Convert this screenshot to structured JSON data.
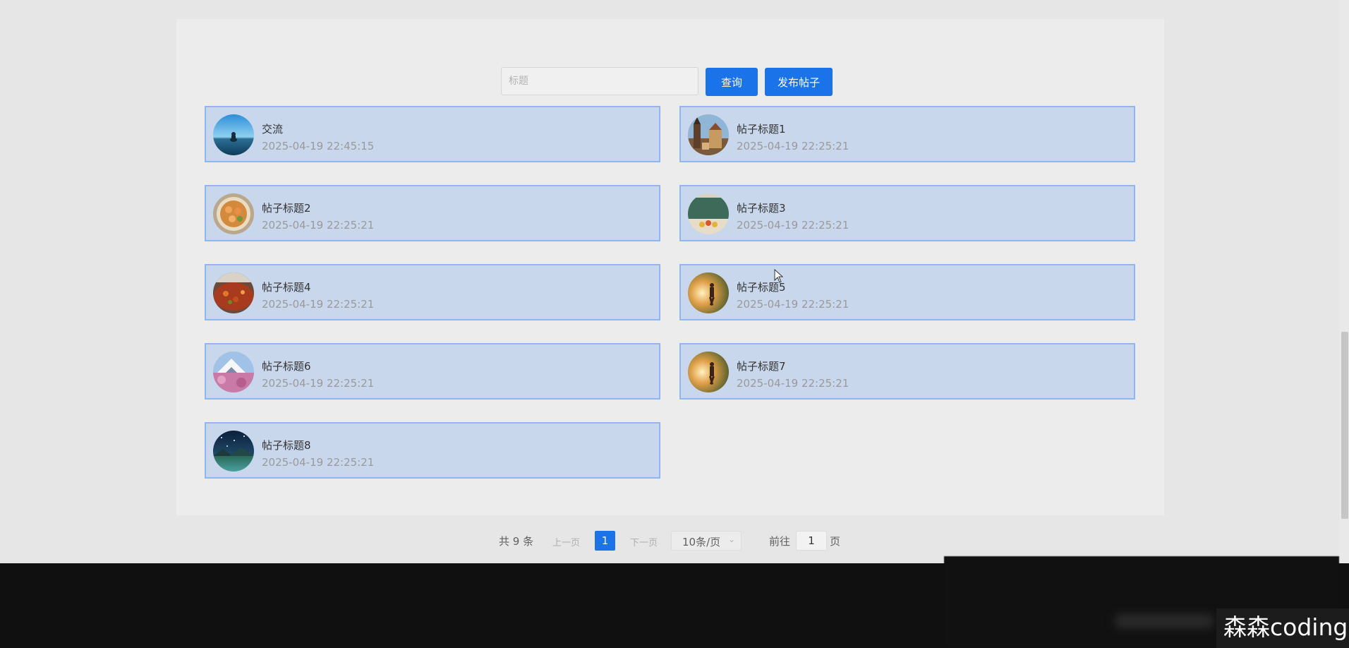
{
  "search": {
    "placeholder": "标题",
    "query_label": "查询",
    "publish_label": "发布帖子"
  },
  "posts": [
    {
      "title": "交流",
      "time": "2025-04-19 22:45:15",
      "avatar": "meditation-lake-image"
    },
    {
      "title": "帖子标题1",
      "time": "2025-04-19 22:25:21",
      "avatar": "old-town-tower-image"
    },
    {
      "title": "帖子标题2",
      "time": "2025-04-19 22:25:21",
      "avatar": "shrimp-dish-image"
    },
    {
      "title": "帖子标题3",
      "time": "2025-04-19 22:25:21",
      "avatar": "classroom-flowers-image"
    },
    {
      "title": "帖子标题4",
      "time": "2025-04-19 22:25:21",
      "avatar": "spicy-food-image"
    },
    {
      "title": "帖子标题5",
      "time": "2025-04-19 22:25:21",
      "avatar": "runner-sunset-image"
    },
    {
      "title": "帖子标题6",
      "time": "2025-04-19 22:25:21",
      "avatar": "mountain-blossom-image"
    },
    {
      "title": "帖子标题7",
      "time": "2025-04-19 22:25:21",
      "avatar": "runner-sunset-image"
    },
    {
      "title": "帖子标题8",
      "time": "2025-04-19 22:25:21",
      "avatar": "starry-lake-image"
    }
  ],
  "pagination": {
    "total": "共 9 条",
    "prev": "上一页",
    "current": "1",
    "next": "下一页",
    "page_size": "10条/页",
    "goto_label": "前往",
    "goto_value": "1",
    "page_label": "页"
  },
  "watermark": "森森coding",
  "colors": {
    "accent": "#1a73e8",
    "card_bg": "#c8d7ec",
    "card_border": "#8db6f2"
  }
}
